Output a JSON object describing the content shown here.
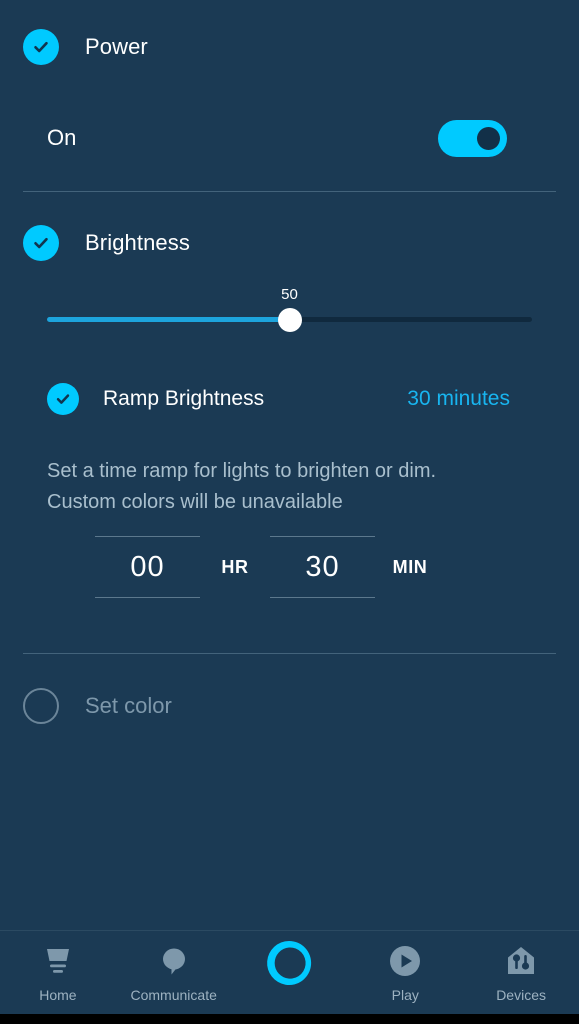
{
  "app": {
    "background_color": "#1b3a54",
    "accent_color": "#00caff",
    "muted_text_color": "#a9bfcd"
  },
  "power": {
    "title": "Power",
    "checked_icon": "check-circle-icon",
    "state_label": "On",
    "toggle_on": true,
    "toggle_name": "power-toggle"
  },
  "brightness": {
    "title": "Brightness",
    "checked_icon": "check-circle-icon",
    "slider": {
      "value": "50",
      "value_number": 50,
      "min": 0,
      "max": 100,
      "percent": 50
    }
  },
  "ramp": {
    "title": "Ramp Brightness",
    "duration": "30 minutes",
    "duration_color": "#18b5f0",
    "checked_icon": "check-circle-icon",
    "description": "Set a time ramp for lights to brighten or dim. Custom colors will be unavailable",
    "time": {
      "hours_value": "00",
      "hours_unit": "HR",
      "minutes_value": "30",
      "minutes_unit": "MIN"
    }
  },
  "set_color": {
    "label": "Set color",
    "checked": false,
    "icon": "empty-circle-icon"
  },
  "bottom_nav": {
    "items": [
      {
        "label": "Home",
        "icon": "home-icon",
        "active": false
      },
      {
        "label": "Communicate",
        "icon": "speech-bubble-icon",
        "active": false
      },
      {
        "label": "",
        "icon": "alexa-ring-icon",
        "active": true
      },
      {
        "label": "Play",
        "icon": "play-circle-icon",
        "active": false
      },
      {
        "label": "Devices",
        "icon": "devices-house-icon",
        "active": false
      }
    ]
  }
}
